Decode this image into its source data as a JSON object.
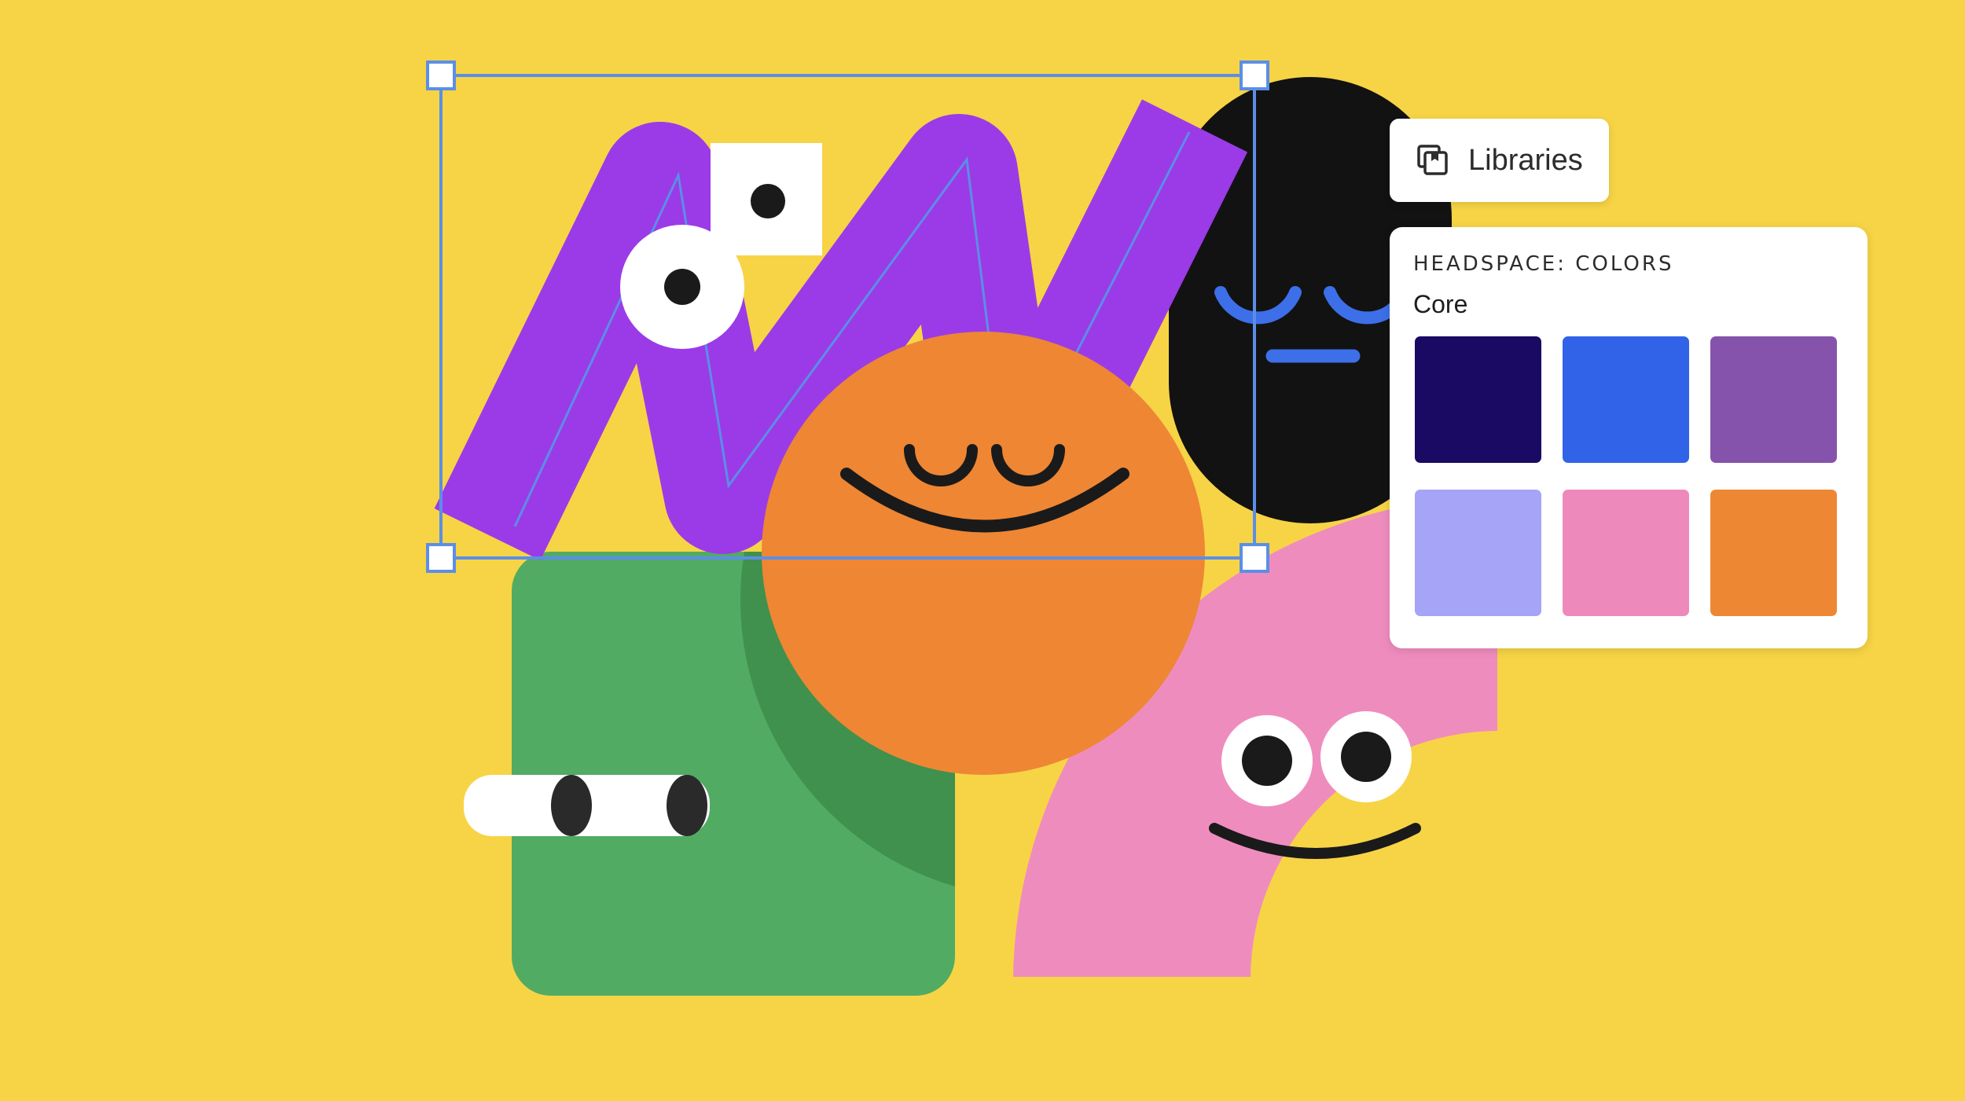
{
  "canvas": {
    "background_color": "#F7D445",
    "selection_color": "#5B8EE6"
  },
  "characters": {
    "zigzag": {
      "color": "#9B3BE7",
      "eye_color": "#1A1A1A"
    },
    "black_pill": {
      "color": "#121212",
      "face_color": "#3D6FE8"
    },
    "orange_circle": {
      "color": "#EE8634",
      "face_color": "#1A1A1A"
    },
    "green_square": {
      "color": "#52AB63",
      "shadow_color": "#3F914D"
    },
    "pink_arch": {
      "color": "#EF8CBE",
      "face_color": "#1A1A1A"
    }
  },
  "libraries_button": {
    "label": "Libraries",
    "icon": "libraries-icon"
  },
  "colors_panel": {
    "title": "HEADSPACE: COLORS",
    "group": "Core",
    "swatches": [
      {
        "color": "#1A0A63"
      },
      {
        "color": "#3063E7"
      },
      {
        "color": "#8553AB"
      },
      {
        "color": "#A6A4F6"
      },
      {
        "color": "#EE8ABB"
      },
      {
        "color": "#EE8734"
      }
    ]
  }
}
